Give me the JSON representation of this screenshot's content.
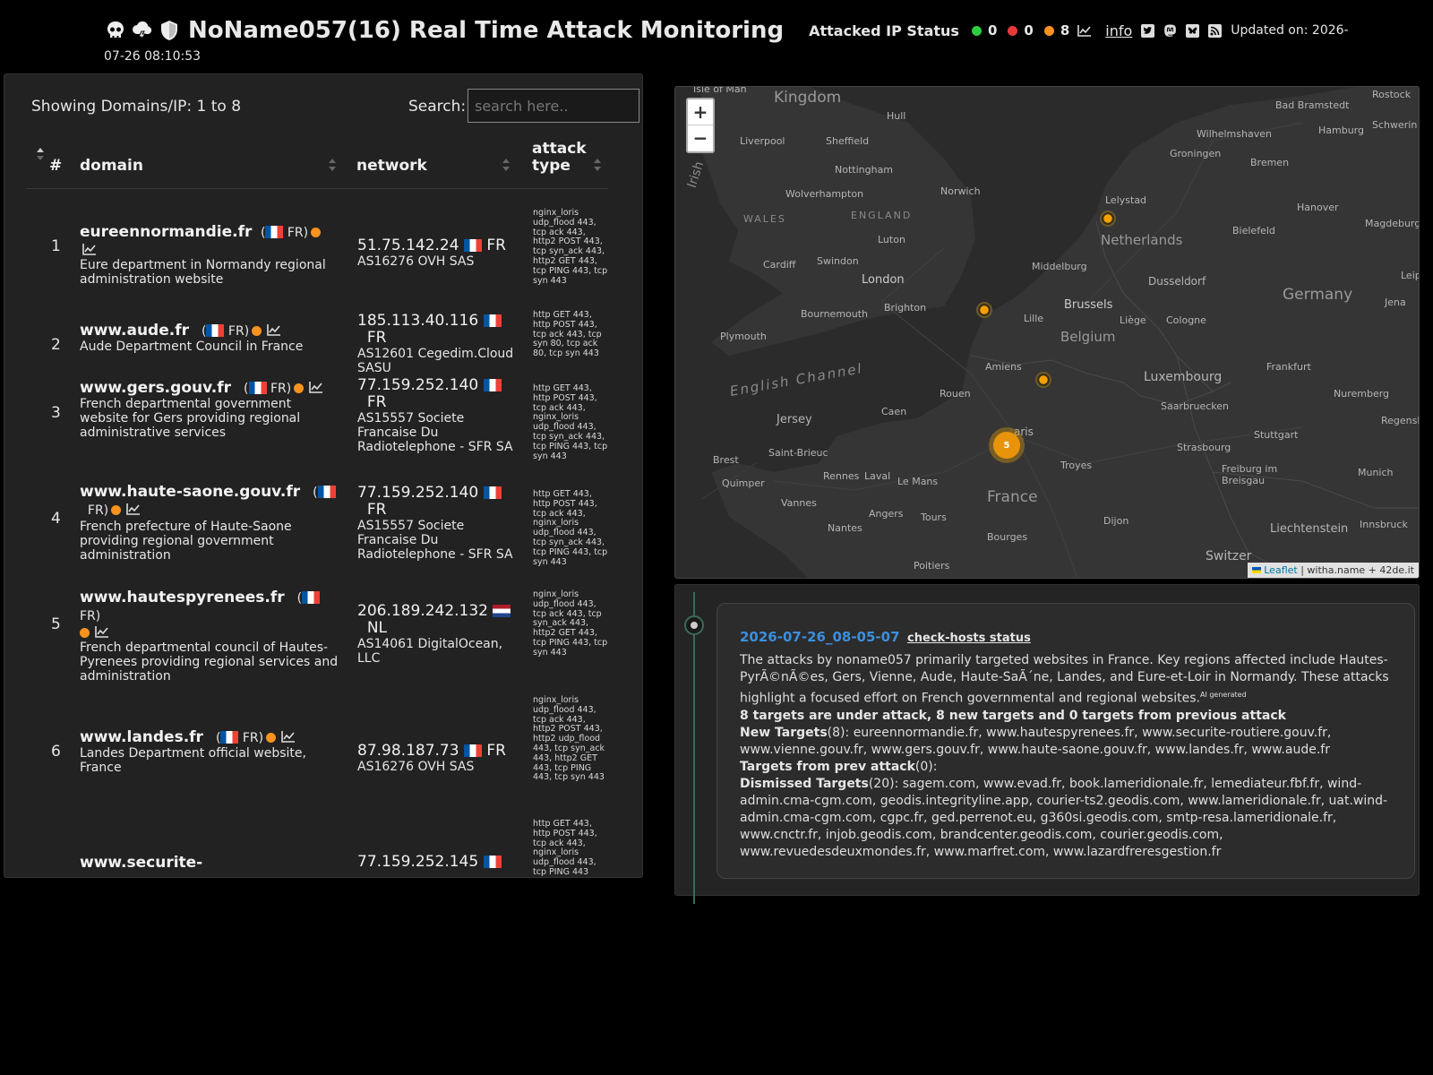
{
  "header": {
    "title": "NoName057(16) Real Time Attack Monitoring",
    "status_label": "Attacked IP Status",
    "status_green": "0",
    "status_red": "0",
    "status_orange": "8",
    "info_label": "info",
    "updated_line1": "Updated on: 2026-",
    "updated_line2": "07-26 08:10:53",
    "colors": {
      "green": "#2ecc40",
      "red": "#e83a3a",
      "orange": "#f7931e"
    },
    "icons": [
      "skull-icon",
      "cloud-lightning-icon",
      "shield-icon",
      "chart-icon",
      "twitter-icon",
      "mastodon-icon",
      "bluesky-icon",
      "rss-icon"
    ]
  },
  "table": {
    "showing": "Showing Domains/IP: 1 to 8",
    "search_label": "Search:",
    "search_placeholder": "search here..",
    "columns": {
      "num": "#",
      "domain": "domain",
      "network": "network",
      "attack": "attack type"
    },
    "rows": [
      {
        "num": "1",
        "domain": "eureennormandie.fr",
        "country": "FR)",
        "desc": "Eure department in Normandy regional administration website",
        "ip": "51.75.142.24",
        "ip_cc": "FR",
        "asn": "AS16276 OVH SAS",
        "attack": "nginx_loris udp_flood 443, tcp ack 443, http2 POST 443, tcp syn_ack 443, http2 GET 443, tcp PING 443, tcp syn 443"
      },
      {
        "num": "2",
        "domain": "www.aude.fr",
        "country": "FR)",
        "desc": "Aude Department Council in France",
        "ip": "185.113.40.116",
        "ip_cc": "FR",
        "asn": "AS12601 Cegedim.Cloud SASU",
        "attack": "http GET 443, http POST 443, tcp ack 443, tcp syn 80, tcp ack 80, tcp syn 443"
      },
      {
        "num": "3",
        "domain": "www.gers.gouv.fr",
        "country": "FR)",
        "desc": "French departmental government website for Gers providing regional administrative services",
        "ip": "77.159.252.140",
        "ip_cc": "FR",
        "asn": "AS15557 Societe Francaise Du Radiotelephone - SFR SA",
        "attack": "http GET 443, http POST 443, tcp ack 443, nginx_loris udp_flood 443, tcp syn_ack 443, tcp PING 443, tcp syn 443"
      },
      {
        "num": "4",
        "domain": "www.haute-saone.gouv.fr",
        "country": "FR)",
        "desc": "French prefecture of Haute-Saone providing regional government administration",
        "ip": "77.159.252.140",
        "ip_cc": "FR",
        "asn": "AS15557 Societe Francaise Du Radiotelephone - SFR SA",
        "attack": "http GET 443, http POST 443, tcp ack 443, nginx_loris udp_flood 443, tcp syn_ack 443, tcp PING 443, tcp syn 443"
      },
      {
        "num": "5",
        "domain": "www.hautespyrenees.fr",
        "country": "FR)",
        "desc": "French departmental council of Hautes-Pyrenees providing regional services and administration",
        "ip": "206.189.242.132",
        "ip_cc": "NL",
        "asn": "AS14061 DigitalOcean, LLC",
        "attack": "nginx_loris udp_flood 443, tcp ack 443, tcp syn_ack 443, http2 GET 443, tcp PING 443, tcp syn 443"
      },
      {
        "num": "6",
        "domain": "www.landes.fr",
        "country": "FR)",
        "desc": "Landes Department official website, France",
        "ip": "87.98.187.73",
        "ip_cc": "FR",
        "asn": "AS16276 OVH SAS",
        "attack": "nginx_loris udp_flood 443, tcp ack 443, http2 POST 443, http2 udp_flood 443, tcp syn_ack 443, http2 GET 443, tcp PING 443, tcp syn 443"
      },
      {
        "num": "",
        "domain": "www.securite-",
        "country": "",
        "desc": "",
        "ip": "77.159.252.145",
        "ip_cc": "",
        "asn": "",
        "attack": "http GET 443, http POST 443, tcp ack 443, nginx_loris udp_flood 443, tcp PING 443"
      }
    ]
  },
  "map": {
    "zoom_in": "+",
    "zoom_out": "−",
    "attribution_leaflet": "Leaflet",
    "attribution_rest": "| witha.name + 42de.it",
    "cluster_count": "5",
    "labels": {
      "kingdom": "Kingdom",
      "isle": "Isle of Man",
      "hull": "Hull",
      "liverpool": "Liverpool",
      "sheffield": "Sheffield",
      "nottingham": "Nottingham",
      "wolverhampton": "Wolverhampton",
      "norwich": "Norwich",
      "wales": "WALES",
      "england": "ENGLAND",
      "luton": "Luton",
      "cardiff": "Cardiff",
      "swindon": "Swindon",
      "london": "London",
      "bournemouth": "Bournemouth",
      "brighton": "Brighton",
      "plymouth": "Plymouth",
      "channel": "English Channel",
      "jersey": "Jersey",
      "caen": "Caen",
      "rouen": "Rouen",
      "amiens": "Amiens",
      "lille": "Lille",
      "brussels": "Brussels",
      "belgium": "Belgium",
      "liege": "Liège",
      "cologne": "Cologne",
      "dusseldorf": "Dusseldorf",
      "netherlands": "Netherlands",
      "lelystad": "Lelystad",
      "middelburg": "Middelburg",
      "groningen": "Groningen",
      "bremen": "Bremen",
      "hamburg": "Hamburg",
      "schwerin": "Schwerin",
      "rostock": "Rostock",
      "badbramstedt": "Bad Bramstedt",
      "wilhelmshaven": "Wilhelmshaven",
      "hanover": "Hanover",
      "bielefeld": "Bielefeld",
      "magdeburg": "Magdeburg",
      "germany": "Germany",
      "jena": "Jena",
      "leip": "Leip",
      "frankfurt": "Frankfurt",
      "luxembourg": "Luxembourg",
      "nuremberg": "Nuremberg",
      "saarbruecken": "Saarbruecken",
      "regensburg": "Regensbu",
      "strasbourg": "Strasbourg",
      "stuttgart": "Stuttgart",
      "freiburg": "Freiburg im Breisgau",
      "munich": "Munich",
      "paris": "aris",
      "brest": "Brest",
      "saintbrieuc": "Saint-Brieuc",
      "quimper": "Quimper",
      "rennes": "Rennes",
      "laval": "Laval",
      "lemans": "Le Mans",
      "vannes": "Vannes",
      "troyes": "Troyes",
      "france": "France",
      "nantes": "Nantes",
      "angers": "Angers",
      "tours": "Tours",
      "dijon": "Dijon",
      "bourges": "Bourges",
      "poitiers": "Poitiers",
      "liechtenstein": "Liechtenstein",
      "innsbruck": "Innsbruck",
      "switzer": "Switzer",
      "irish": "Irish"
    }
  },
  "timeline": {
    "date": "2026-07-26_08-05-07",
    "check": "check-hosts status",
    "summary": "The attacks by noname057 primarily targeted websites in France. Key regions affected include Hautes-PyrÃ©nÃ©es, Gers, Vienne, Aude, Haute-SaÃ´ne, Landes, and Eure-et-Loir in Normandy. These attacks highlight a focused effort on French governmental and regional websites.",
    "ai": "AI generated",
    "count_line": "8 targets are under attack, 8 new targets and 0 targets from previous attack",
    "new_label": "New Targets",
    "new_count": "(8):",
    "new_list": "eureennormandie.fr, www.hautespyrenees.fr, www.securite-routiere.gouv.fr, www.vienne.gouv.fr, www.gers.gouv.fr, www.haute-saone.gouv.fr, www.landes.fr, www.aude.fr",
    "prev_label": "Targets from prev attack",
    "prev_count": "(0):",
    "dismissed_label": "Dismissed Targets",
    "dismissed_count": "(20):",
    "dismissed_list": "sagem.com, www.evad.fr, book.lameridionale.fr, lemediateur.fbf.fr, wind-admin.cma-cgm.com, geodis.integrityline.app, courier-ts2.geodis.com, www.lameridionale.fr, uat.wind-admin.cma-cgm.com, cgpc.fr, ged.perrenot.eu, g360si.geodis.com, smtp-resa.lameridionale.fr, www.cnctr.fr, injob.geodis.com, brandcenter.geodis.com, courier.geodis.com, www.revuedesdeuxmondes.fr, www.marfret.com, www.lazardfreresgestion.fr"
  }
}
